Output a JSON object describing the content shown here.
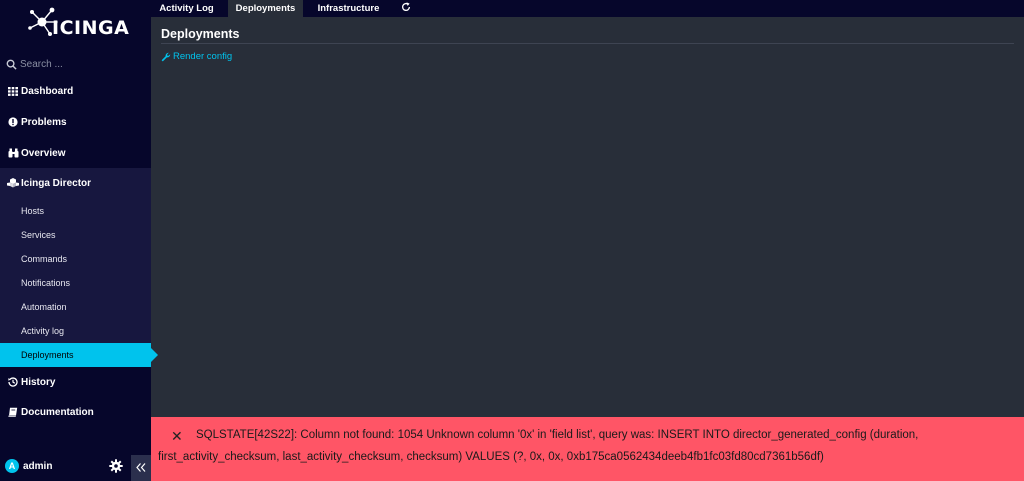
{
  "brand": {
    "name": "icinga"
  },
  "search": {
    "placeholder": "Search ..."
  },
  "nav": {
    "dashboard": "Dashboard",
    "problems": "Problems",
    "overview": "Overview",
    "director": "Icinga Director",
    "director_items": [
      "Hosts",
      "Services",
      "Commands",
      "Notifications",
      "Automation",
      "Activity log",
      "Deployments"
    ],
    "history": "History",
    "documentation": "Documentation"
  },
  "user": {
    "initial": "A",
    "name": "admin"
  },
  "tabs": [
    "Activity Log",
    "Deployments",
    "Infrastructure"
  ],
  "main": {
    "title": "Deployments",
    "render_config": "Render config"
  },
  "error": {
    "message": "SQLSTATE[42S22]: Column not found: 1054 Unknown column '0x' in 'field list', query was: INSERT INTO director_generated_config (duration, first_activity_checksum, last_activity_checksum, checksum) VALUES (?, 0x, 0x, 0xb175ca0562434deeb4fb1fc03fd80cd7361b56df)"
  },
  "colors": {
    "accent": "#00c3ed",
    "sidebar": "#06062b",
    "error": "#ff5566",
    "content": "#282e39"
  }
}
